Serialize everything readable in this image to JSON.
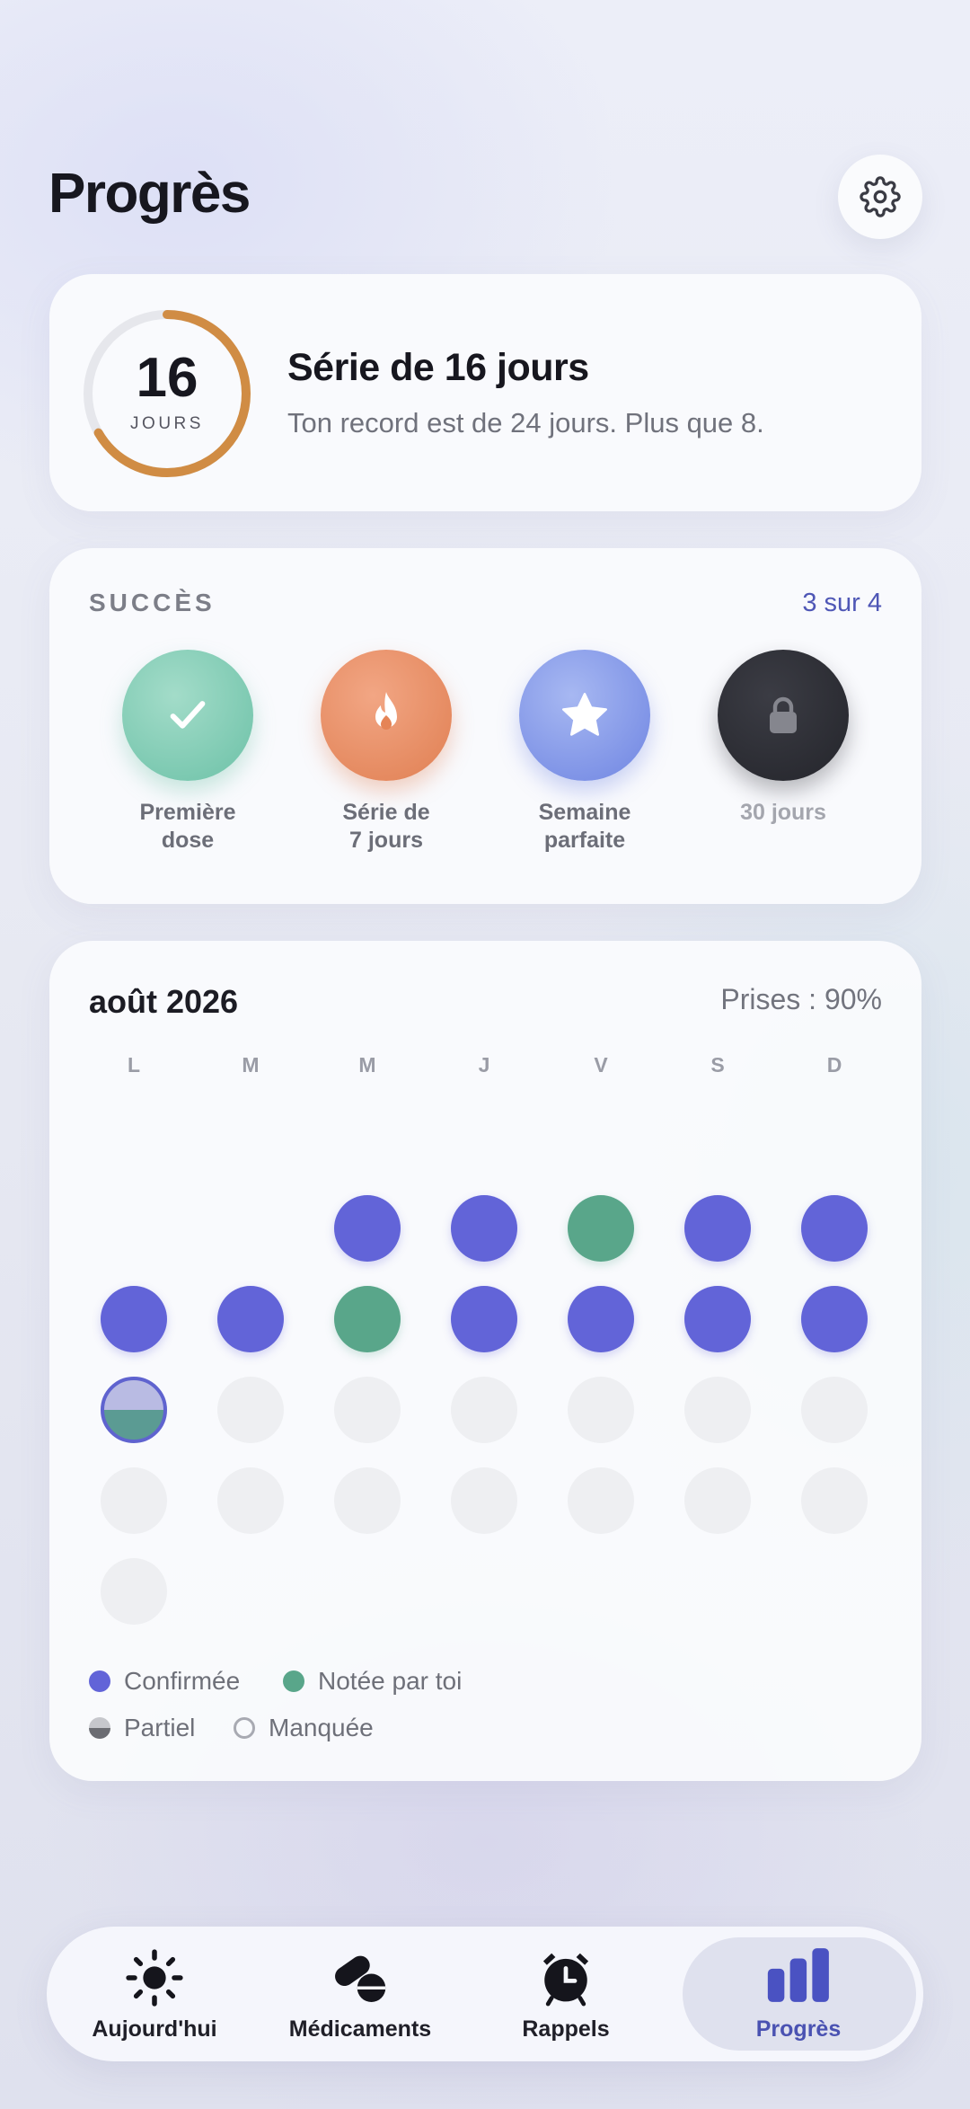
{
  "header": {
    "title": "Progrès",
    "settings_icon": "gear-icon"
  },
  "streak": {
    "days": "16",
    "unit": "JOURS",
    "progress": 0.667,
    "title": "Série de 16 jours",
    "subtitle": "Ton record est de 24 jours. Plus que 8."
  },
  "achievements": {
    "heading": "SUCCÈS",
    "count": "3 sur 4",
    "badges": [
      {
        "label": "Première\ndose",
        "icon": "checkmark-icon",
        "color": "#7fcdb6",
        "locked": false
      },
      {
        "label": "Série de\n7 jours",
        "icon": "flame-icon",
        "color": "#e98c5c",
        "locked": false
      },
      {
        "label": "Semaine\nparfaite",
        "icon": "star-icon",
        "color": "#7f95e8",
        "locked": false
      },
      {
        "label": "30 jours",
        "icon": "lock-icon",
        "color": "#2c2d34",
        "locked": true
      }
    ]
  },
  "calendar": {
    "month": "août 2026",
    "rate": "Prises : 90%",
    "weekdays": [
      "L",
      "M",
      "M",
      "J",
      "V",
      "S",
      "D"
    ],
    "weeks": [
      [
        null,
        null,
        null,
        null,
        null,
        null,
        null
      ],
      [
        null,
        null,
        "confirmed",
        "confirmed",
        "noted",
        "confirmed",
        "confirmed"
      ],
      [
        "confirmed",
        "confirmed",
        "noted",
        "confirmed",
        "confirmed",
        "confirmed",
        "confirmed"
      ],
      [
        "partial-today",
        "future",
        "future",
        "future",
        "future",
        "future",
        "future"
      ],
      [
        "future",
        "future",
        "future",
        "future",
        "future",
        "future",
        "future"
      ],
      [
        "future",
        null,
        null,
        null,
        null,
        null,
        null
      ]
    ],
    "legend": {
      "confirmed": "Confirmée",
      "noted": "Notée par toi",
      "partial": "Partiel",
      "missed": "Manquée"
    },
    "colors": {
      "confirmed": "#6264d8",
      "noted": "#59a68a",
      "accent": "#4f57b6"
    }
  },
  "tabbar": {
    "tabs": [
      {
        "label": "Aujourd'hui",
        "icon": "sun-icon",
        "active": false
      },
      {
        "label": "Médicaments",
        "icon": "pills-icon",
        "active": false
      },
      {
        "label": "Rappels",
        "icon": "alarm-clock-icon",
        "active": false
      },
      {
        "label": "Progrès",
        "icon": "bar-chart-icon",
        "active": true
      }
    ]
  }
}
